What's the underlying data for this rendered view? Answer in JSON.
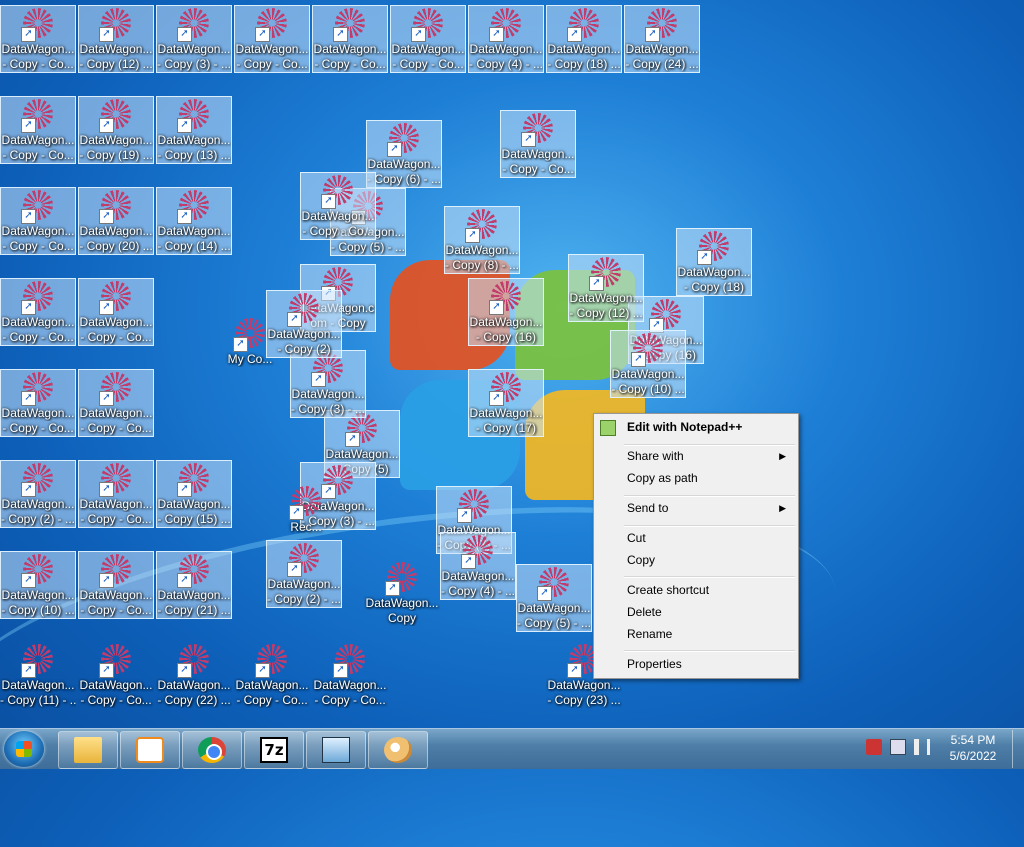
{
  "desktop": {
    "icons": [
      {
        "l1": "DataWagon...",
        "l2": "- Copy - Co..."
      },
      {
        "l1": "DataWagon...",
        "l2": "- Copy (12) ..."
      },
      {
        "l1": "DataWagon...",
        "l2": "- Copy (3) - ..."
      },
      {
        "l1": "DataWagon...",
        "l2": "- Copy - Co..."
      },
      {
        "l1": "DataWagon...",
        "l2": "- Copy - Co..."
      },
      {
        "l1": "DataWagon...",
        "l2": "- Copy - Co..."
      },
      {
        "l1": "DataWagon...",
        "l2": "- Copy (4) - ..."
      },
      {
        "l1": "DataWagon...",
        "l2": "- Copy (18) ..."
      },
      {
        "l1": "DataWagon...",
        "l2": "- Copy (24) ..."
      },
      {
        "l1": "DataWagon...",
        "l2": "- Copy - Co..."
      },
      {
        "l1": "DataWagon...",
        "l2": "- Copy (19) ..."
      },
      {
        "l1": "DataWagon...",
        "l2": "- Copy (13) ..."
      },
      {
        "l1": "DataWagon...",
        "l2": "- Copy - Co..."
      },
      {
        "l1": "DataWagon...",
        "l2": "- Copy (20) ..."
      },
      {
        "l1": "DataWagon...",
        "l2": "- Copy (14) ..."
      },
      {
        "l1": "DataWagon...",
        "l2": "- Copy - Co..."
      },
      {
        "l1": "DataWagon...",
        "l2": "- Copy - Co..."
      },
      {
        "l1": "DataWagon...",
        "l2": "- Copy - Co..."
      },
      {
        "l1": "DataWagon...",
        "l2": "- Copy - Co..."
      },
      {
        "l1": "DataWagon...",
        "l2": "- Copy (2) - ..."
      },
      {
        "l1": "DataWagon...",
        "l2": "- Copy - Co..."
      },
      {
        "l1": "DataWagon...",
        "l2": "- Copy (15) ..."
      },
      {
        "l1": "DataWagon...",
        "l2": "- Copy (10) ..."
      },
      {
        "l1": "DataWagon...",
        "l2": "- Copy - Co..."
      },
      {
        "l1": "DataWagon...",
        "l2": "- Copy (21) ..."
      },
      {
        "l1": "DataWagon...",
        "l2": "- Copy (11) - ..."
      },
      {
        "l1": "DataWagon...",
        "l2": "- Copy - Co..."
      },
      {
        "l1": "DataWagon...",
        "l2": "- Copy (22) ..."
      },
      {
        "l1": "DataWagon...",
        "l2": "- Copy - Co..."
      },
      {
        "l1": "DataWagon...",
        "l2": "- Copy - Co..."
      },
      {
        "l1": "DataWagon...",
        "l2": "- Copy (23) ..."
      },
      {
        "l1": "DataWagon...",
        "l2": "- Copy (6) - ..."
      },
      {
        "l1": "DataWagon...",
        "l2": "- Copy (5) - ..."
      },
      {
        "l1": "DataWagon...",
        "l2": "- Copy (8) - ..."
      },
      {
        "l1": "DataWagon...",
        "l2": "- Copy (16)"
      },
      {
        "l1": "DataWagon...",
        "l2": "- Copy (17)"
      },
      {
        "l1": "DataWagon...",
        "l2": "- Copy (18)"
      },
      {
        "l1": "DataWagon...",
        "l2": "- Copy (16)"
      },
      {
        "l1": "DataWagon.c",
        "l2": "om - Copy"
      },
      {
        "l1": "DataWagon...",
        "l2": "- Copy (5)"
      },
      {
        "l1": "DataWagon...",
        "l2": "- Copy (3) - ..."
      },
      {
        "l1": "DataWagon...",
        "l2": "- Copy (7) - ..."
      },
      {
        "l1": "DataWagon...",
        "l2": "- Copy (4) - ..."
      },
      {
        "l1": "DataWagon...",
        "l2": "- Copy (2) - ..."
      },
      {
        "l1": "DataWagon...",
        "l2": "- Copy (3) - ..."
      },
      {
        "l1": "DataWagon...",
        "l2": "- Copy - Co..."
      },
      {
        "l1": "DataWagon...",
        "l2": "- Copy (5) - ..."
      },
      {
        "l1": "DataWagon...",
        "l2": "- Copy - Co..."
      },
      {
        "l1": "DataWagon...",
        "l2": "- Copy (2)"
      },
      {
        "l1": "DataWagon...",
        "l2": "- Copy (12) ..."
      },
      {
        "l1": "DataWagon...",
        "l2": "- Copy (10) ..."
      },
      {
        "l1": "DataWagon...",
        "l2": "Copy"
      },
      {
        "l1": "My Co...",
        "l2": ""
      },
      {
        "l1": "Rec...",
        "l2": ""
      }
    ]
  },
  "context_menu": {
    "edit_notepad": "Edit with Notepad++",
    "share_with": "Share with",
    "copy_as_path": "Copy as path",
    "send_to": "Send to",
    "cut": "Cut",
    "copy": "Copy",
    "create_shortcut": "Create shortcut",
    "delete": "Delete",
    "rename": "Rename",
    "properties": "Properties",
    "submenu_arrow": "▶"
  },
  "taskbar": {
    "time": "5:54 PM",
    "date": "5/6/2022",
    "sevenzip_label": "7z",
    "colors": {
      "accent": "#4f7fa8"
    }
  },
  "icon_glyph": "➚"
}
